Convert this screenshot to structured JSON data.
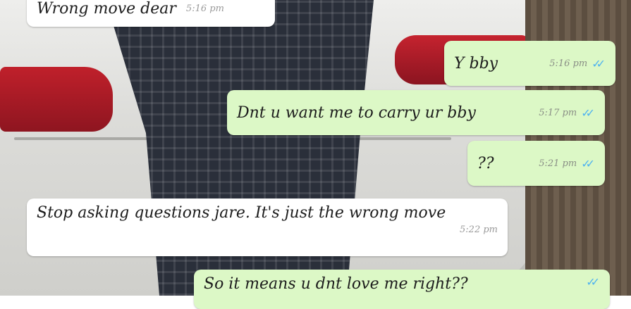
{
  "chat": {
    "messages": [
      {
        "direction": "in",
        "text": "Wrong move dear",
        "time": "5:16 pm"
      },
      {
        "direction": "out",
        "text": "Y bby",
        "time": "5:16 pm",
        "read": true
      },
      {
        "direction": "out",
        "text": "Dnt u want me to carry ur bby",
        "time": "5:17 pm",
        "read": true
      },
      {
        "direction": "out",
        "text": "??",
        "time": "5:21 pm",
        "read": true
      },
      {
        "direction": "in",
        "text": "Stop asking questions jare. It's just the wrong move",
        "time": "5:22 pm"
      },
      {
        "direction": "out",
        "text": "So it means u dnt love me right??",
        "time": "",
        "read": true
      }
    ]
  },
  "theme": {
    "incoming_bubble": "#ffffff",
    "outgoing_bubble": "#dcf8c6",
    "read_tick_color": "#4fb3f0"
  },
  "icons": {
    "read_receipt": "double-check-icon"
  }
}
